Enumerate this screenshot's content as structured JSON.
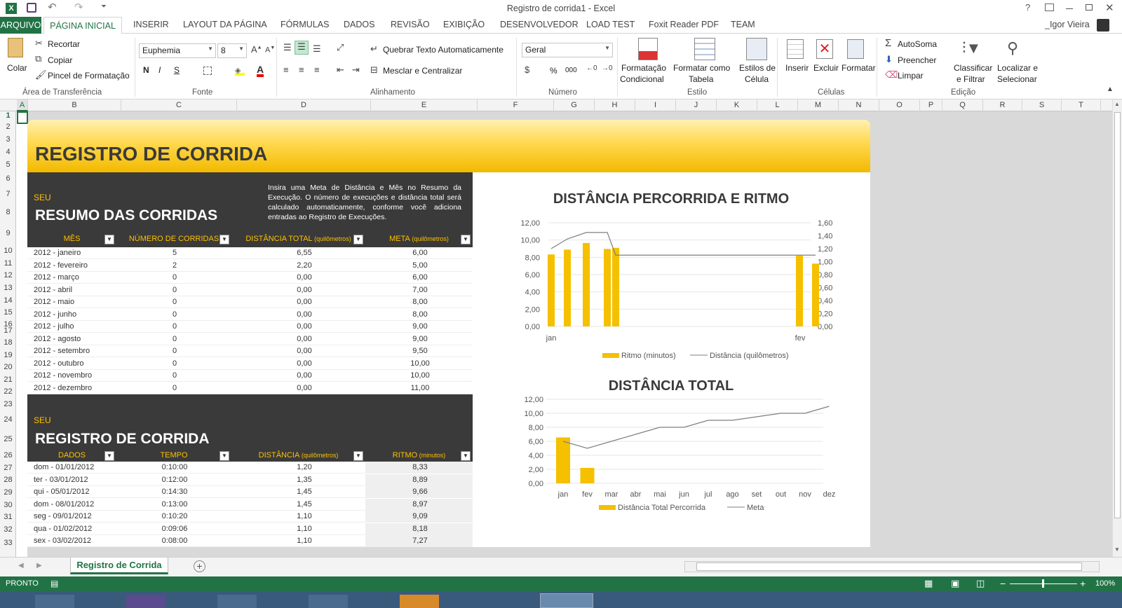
{
  "window": {
    "title": "Registro de corrida1 - Excel",
    "user": "_Igor Vieira",
    "help": "?"
  },
  "ribbon_tabs": [
    "ARQUIVO",
    "PÁGINA INICIAL",
    "INSERIR",
    "LAYOUT DA PÁGINA",
    "FÓRMULAS",
    "DADOS",
    "REVISÃO",
    "EXIBIÇÃO",
    "DESENVOLVEDOR",
    "LOAD TEST",
    "Foxit Reader PDF",
    "TEAM"
  ],
  "ribbon": {
    "clipboard": {
      "paste": "Colar",
      "cut": "Recortar",
      "copy": "Copiar",
      "format_painter": "Pincel de Formatação",
      "group": "Área de Transferência"
    },
    "font": {
      "name": "Euphemia",
      "size": "8",
      "bold": "N",
      "italic": "I",
      "underline": "S",
      "group": "Fonte"
    },
    "alignment": {
      "wrap": "Quebrar Texto Automaticamente",
      "merge": "Mesclar e Centralizar",
      "group": "Alinhamento"
    },
    "number": {
      "format": "Geral",
      "percent": "%",
      "thousands": "000",
      "group": "Número"
    },
    "styles": {
      "cond1": "Formatação",
      "cond2": "Condicional",
      "table1": "Formatar como",
      "table2": "Tabela",
      "cell1": "Estilos de",
      "cell2": "Célula",
      "group": "Estilo"
    },
    "cells": {
      "insert": "Inserir",
      "delete": "Excluir",
      "format": "Formatar",
      "group": "Células"
    },
    "editing": {
      "autosum": "AutoSoma",
      "fill": "Preencher",
      "clear": "Limpar",
      "sort1": "Classificar",
      "sort2": "e Filtrar",
      "find1": "Localizar e",
      "find2": "Selecionar",
      "group": "Edição"
    }
  },
  "columns": [
    "A",
    "B",
    "C",
    "D",
    "E",
    "F",
    "G",
    "H",
    "I",
    "J",
    "K",
    "L",
    "M",
    "N",
    "O",
    "P",
    "Q",
    "R",
    "S",
    "T",
    "U"
  ],
  "rows": [
    "1",
    "2",
    "3",
    "4",
    "5",
    "6",
    "7",
    "8",
    "9",
    "10",
    "11",
    "12",
    "13",
    "14",
    "15",
    "16",
    "17",
    "18",
    "19",
    "20",
    "21",
    "22",
    "23",
    "24",
    "25",
    "26",
    "27",
    "28",
    "29",
    "30",
    "31",
    "32",
    "33"
  ],
  "banner_title": "REGISTRO DE CORRIDA",
  "summary": {
    "kicker": "SEU",
    "title": "RESUMO DAS CORRIDAS",
    "instructions": "Insira uma Meta de Distância e Mês no Resumo da Execução. O número de execuções e distância total será calculado automaticamente, conforme você adiciona entradas ao Registro de Execuções.",
    "headers": [
      {
        "t": "MÊS",
        "u": ""
      },
      {
        "t": "NÚMERO  DE  CORRIDAS",
        "u": ""
      },
      {
        "t": "DISTÂNCIA  TOTAL",
        "u": "(quilômetros)"
      },
      {
        "t": "META",
        "u": "(quilômetros)"
      }
    ],
    "rows": [
      [
        "2012  -  janeiro",
        "5",
        "6,55",
        "6,00"
      ],
      [
        "2012  -  fevereiro",
        "2",
        "2,20",
        "5,00"
      ],
      [
        "2012  -  março",
        "0",
        "0,00",
        "6,00"
      ],
      [
        "2012  -  abril",
        "0",
        "0,00",
        "7,00"
      ],
      [
        "2012  -  maio",
        "0",
        "0,00",
        "8,00"
      ],
      [
        "2012  -  junho",
        "0",
        "0,00",
        "8,00"
      ],
      [
        "2012  -  julho",
        "0",
        "0,00",
        "9,00"
      ],
      [
        "2012  -  agosto",
        "0",
        "0,00",
        "9,00"
      ],
      [
        "2012  -  setembro",
        "0",
        "0,00",
        "9,50"
      ],
      [
        "2012  -  outubro",
        "0",
        "0,00",
        "10,00"
      ],
      [
        "2012  -  novembro",
        "0",
        "0,00",
        "10,00"
      ],
      [
        "2012  -  dezembro",
        "0",
        "0,00",
        "11,00"
      ]
    ]
  },
  "log": {
    "kicker": "SEU",
    "title": "REGISTRO DE CORRIDA",
    "headers": [
      {
        "t": "DADOS",
        "u": ""
      },
      {
        "t": "TEMPO",
        "u": ""
      },
      {
        "t": "DISTÂNCIA",
        "u": "(quilômetros)"
      },
      {
        "t": "RITMO",
        "u": "(minutos)"
      }
    ],
    "rows": [
      [
        "dom  -  01/01/2012",
        "0:10:00",
        "1,20",
        "8,33"
      ],
      [
        "ter  -  03/01/2012",
        "0:12:00",
        "1,35",
        "8,89"
      ],
      [
        "qui  -  05/01/2012",
        "0:14:30",
        "1,45",
        "9,66"
      ],
      [
        "dom  -  08/01/2012",
        "0:13:00",
        "1,45",
        "8,97"
      ],
      [
        "seg  -  09/01/2012",
        "0:10:20",
        "1,10",
        "9,09"
      ],
      [
        "qua  -  01/02/2012",
        "0:09:06",
        "1,10",
        "8,18"
      ],
      [
        "sex  -  03/02/2012",
        "0:08:00",
        "1,10",
        "7,27"
      ]
    ]
  },
  "chart_data": [
    {
      "type": "bar",
      "title": "DISTÂNCIA PERCORRIDA E RITMO",
      "x_labels": [
        "jan",
        "fev"
      ],
      "y_ticks": [
        "0,00",
        "2,00",
        "4,00",
        "6,00",
        "8,00",
        "10,00",
        "12,00"
      ],
      "y2_ticks": [
        "0,00",
        "0,20",
        "0,40",
        "0,60",
        "0,80",
        "1,00",
        "1,20",
        "1,40",
        "1,60"
      ],
      "ylim": [
        0,
        12
      ],
      "y2lim": [
        0,
        1.6
      ],
      "series": [
        {
          "name": "Ritmo  (minutos)",
          "kind": "bar",
          "color": "#f5c000",
          "values": [
            8.33,
            8.89,
            9.66,
            8.97,
            9.09,
            8.18,
            7.27
          ]
        },
        {
          "name": "Distância  (quilômetros)",
          "kind": "line",
          "axis": "secondary",
          "color": "#7f7f7f",
          "values": [
            1.2,
            1.35,
            1.45,
            1.45,
            1.1,
            1.1,
            1.1
          ]
        }
      ]
    },
    {
      "type": "bar",
      "title": "DISTÂNCIA TOTAL",
      "categories": [
        "jan",
        "fev",
        "mar",
        "abr",
        "mai",
        "jun",
        "jul",
        "ago",
        "set",
        "out",
        "nov",
        "dez"
      ],
      "y_ticks": [
        "0,00",
        "2,00",
        "4,00",
        "6,00",
        "8,00",
        "10,00",
        "12,00"
      ],
      "ylim": [
        0,
        12
      ],
      "series": [
        {
          "name": "Distância  Total  Percorrida",
          "kind": "bar",
          "color": "#f5c000",
          "values": [
            6.55,
            2.2,
            0,
            0,
            0,
            0,
            0,
            0,
            0,
            0,
            0,
            0
          ]
        },
        {
          "name": "Meta",
          "kind": "line",
          "color": "#7f7f7f",
          "values": [
            6,
            5,
            6,
            7,
            8,
            8,
            9,
            9,
            9.5,
            10,
            10,
            11
          ]
        }
      ]
    }
  ],
  "sheet_tab": "Registro de Corrida",
  "status": {
    "ready": "PRONTO",
    "zoom": "100%"
  }
}
